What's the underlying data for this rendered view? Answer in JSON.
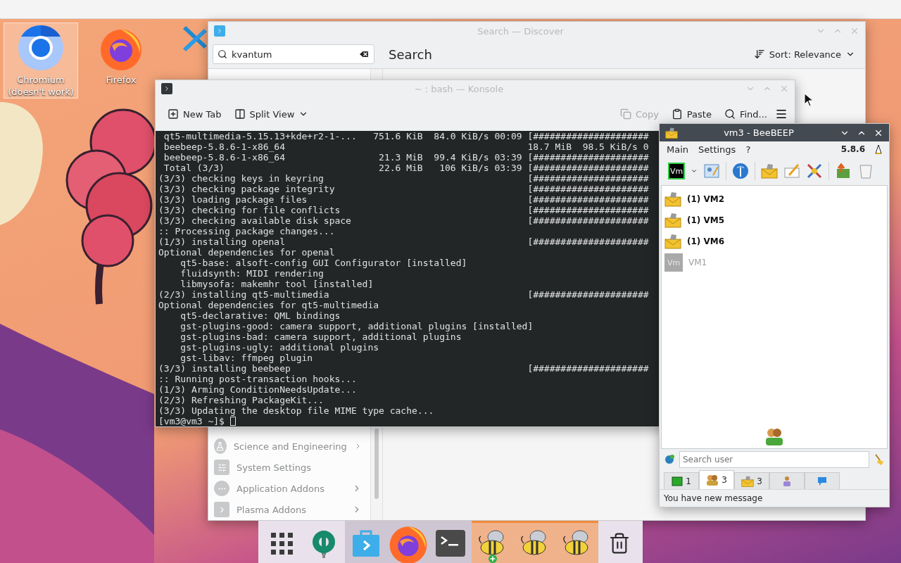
{
  "desktop_icons": [
    {
      "kind": "chromium",
      "label": "Chromium (doesn't work)",
      "selected": true
    },
    {
      "kind": "firefox",
      "label": "Firefox",
      "selected": false
    },
    {
      "kind": "editor",
      "selected": false
    }
  ],
  "discover": {
    "title": "Search — Discover",
    "search": {
      "value": "kvantum"
    },
    "heading": "Search",
    "sort": "Sort: Relevance",
    "sidebar": [
      {
        "kind": "science",
        "label": "Science and Engineering",
        "has_children": true
      },
      {
        "kind": "settings",
        "label": "System Settings",
        "has_children": false
      },
      {
        "kind": "addons",
        "label": "Application Addons",
        "has_children": true
      },
      {
        "kind": "plasma",
        "label": "Plasma Addons",
        "has_children": true
      }
    ]
  },
  "konsole": {
    "title": "~ : bash — Konsole",
    "toolbar": [
      {
        "kind": "new-tab",
        "label": "New Tab",
        "disabled": false
      },
      {
        "kind": "split",
        "label": "Split View",
        "disabled": false
      },
      {
        "kind": "copy",
        "label": "Copy",
        "disabled": true
      },
      {
        "kind": "paste",
        "label": "Paste",
        "disabled": false
      },
      {
        "kind": "find",
        "label": "Find...",
        "disabled": false
      }
    ],
    "lines": [
      {
        "text": " qt5-multimedia-5.15.13+kde+r2-1-...   751.6 KiB  84.0 KiB/s 00:09",
        "right": "[#####################"
      },
      {
        "text": " beebeep-5.8.6-1-x86_64",
        "right": "18.7 MiB  98.5 KiB/s 0"
      },
      {
        "text": " beebeep-5.8.6-1-x86_64                 21.3 MiB  99.4 KiB/s 03:39",
        "right": "[#####################"
      },
      {
        "text": " Total (3/3)                            22.6 MiB   106 KiB/s 03:39",
        "right": "[#####################"
      },
      {
        "text": "(3/3) checking keys in keyring",
        "right": "[#####################"
      },
      {
        "text": "(3/3) checking package integrity",
        "right": "[#####################"
      },
      {
        "text": "(3/3) loading package files",
        "right": "[#####################"
      },
      {
        "text": "(3/3) checking for file conflicts",
        "right": "[#####################"
      },
      {
        "text": "(3/3) checking available disk space",
        "right": "[#####################"
      },
      {
        "text": ":: Processing package changes..."
      },
      {
        "text": "(1/3) installing openal",
        "right": "[#####################"
      },
      {
        "text": "Optional dependencies for openal"
      },
      {
        "text": "    qt5-base: alsoft-config GUI Configurator [installed]"
      },
      {
        "text": "    fluidsynth: MIDI rendering"
      },
      {
        "text": "    libmysofa: makemhr tool [installed]"
      },
      {
        "text": "(2/3) installing qt5-multimedia",
        "right": "[#####################"
      },
      {
        "text": "Optional dependencies for qt5-multimedia"
      },
      {
        "text": "    qt5-declarative: QML bindings"
      },
      {
        "text": "    gst-plugins-good: camera support, additional plugins [installed]"
      },
      {
        "text": "    gst-plugins-bad: camera support, additional plugins"
      },
      {
        "text": "    gst-plugins-ugly: additional plugins"
      },
      {
        "text": "    gst-libav: ffmpeg plugin"
      },
      {
        "text": "(3/3) installing beebeep",
        "right": "[#####################"
      },
      {
        "text": ":: Running post-transaction hooks..."
      },
      {
        "text": "(1/3) Arming ConditionNeedsUpdate..."
      },
      {
        "text": "(2/3) Refreshing PackageKit..."
      },
      {
        "text": "(3/3) Updating the desktop file MIME type cache..."
      }
    ],
    "prompt": "[vm3@vm3 ~]$"
  },
  "beebeep": {
    "title": "vm3 - BeeBEEP",
    "menu": [
      "Main",
      "Settings",
      "?"
    ],
    "version": "5.8.6",
    "avatar": "Vm",
    "users": [
      {
        "name": "(1) VM2",
        "online": true
      },
      {
        "name": "(1) VM5",
        "online": true
      },
      {
        "name": "(1) VM6",
        "online": true
      },
      {
        "name": "VM1",
        "online": false,
        "avatar": "Vm"
      }
    ],
    "search": {
      "placeholder": "Search user"
    },
    "tabs": [
      {
        "kind": "monitor",
        "count": "1",
        "selected": false
      },
      {
        "kind": "people",
        "count": "3",
        "selected": true
      },
      {
        "kind": "mail",
        "count": "3",
        "selected": false
      },
      {
        "kind": "group",
        "selected": false
      },
      {
        "kind": "chat",
        "selected": false
      }
    ],
    "status": "You have new message"
  },
  "taskbar": [
    {
      "kind": "launcher",
      "running": false,
      "attention": false,
      "badge": false
    },
    {
      "kind": "settings",
      "running": false,
      "attention": false,
      "badge": false
    },
    {
      "kind": "discover",
      "running": true,
      "attention": false,
      "badge": false
    },
    {
      "kind": "firefox",
      "running": true,
      "attention": false,
      "badge": false
    },
    {
      "kind": "terminal",
      "running": true,
      "attention": false,
      "badge": false
    },
    {
      "kind": "bee",
      "running": true,
      "attention": true,
      "badge": true
    },
    {
      "kind": "bee",
      "running": true,
      "attention": true,
      "badge": false
    },
    {
      "kind": "bee",
      "running": true,
      "attention": true,
      "badge": false
    },
    {
      "kind": "trash",
      "running": false,
      "attention": false,
      "badge": false
    }
  ]
}
